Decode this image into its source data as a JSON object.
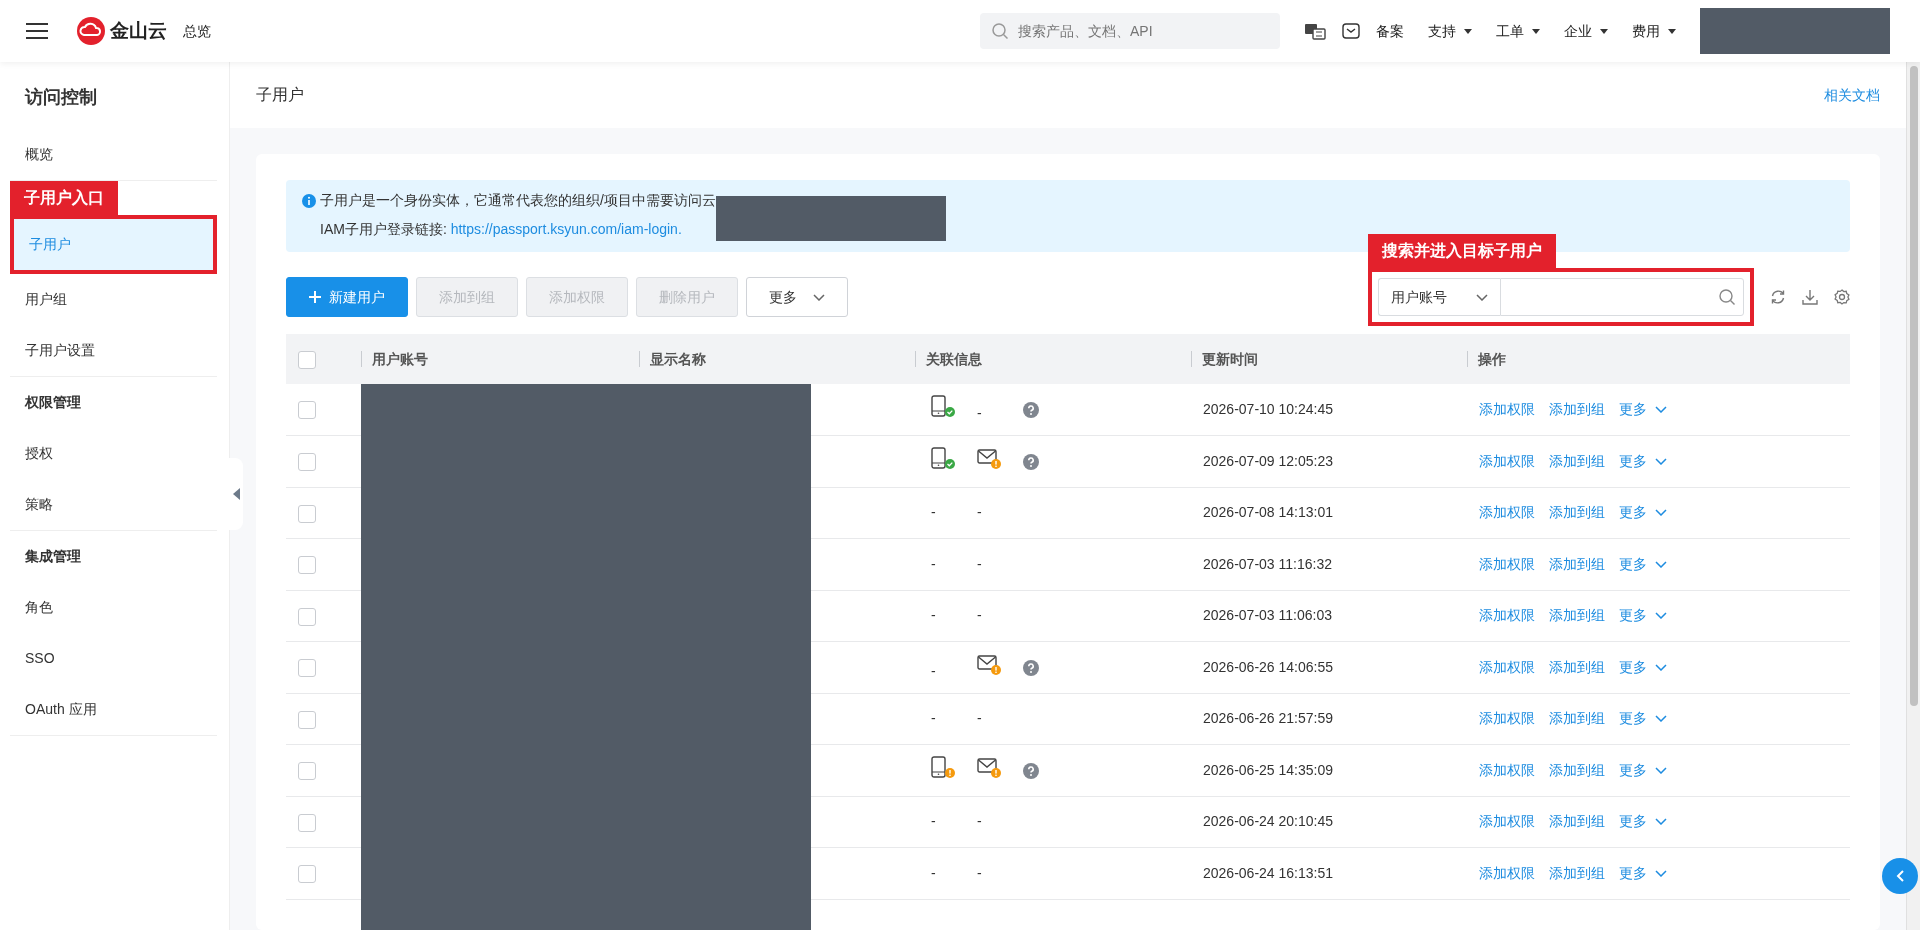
{
  "header": {
    "logo": "金山云",
    "overview": "总览",
    "search": {
      "placeholder": "搜索产品、文档、API"
    },
    "links": [
      {
        "label": "备案",
        "dropdown": false
      },
      {
        "label": "支持",
        "dropdown": true
      },
      {
        "label": "工单",
        "dropdown": true
      },
      {
        "label": "企业",
        "dropdown": true
      },
      {
        "label": "费用",
        "dropdown": true
      }
    ]
  },
  "sidebar": {
    "title": "访问控制",
    "groups": [
      {
        "items": [
          {
            "label": "概览",
            "selected": false
          }
        ]
      },
      {
        "items": [
          {
            "label": "子用户",
            "selected": true
          },
          {
            "label": "用户组",
            "selected": false
          },
          {
            "label": "子用户设置",
            "selected": false
          }
        ]
      },
      {
        "heading": "权限管理",
        "items": [
          {
            "label": "授权",
            "selected": false
          },
          {
            "label": "策略",
            "selected": false
          }
        ]
      },
      {
        "heading": "集成管理",
        "items": [
          {
            "label": "角色",
            "selected": false
          },
          {
            "label": "SSO",
            "selected": false
          },
          {
            "label": "OAuth 应用",
            "selected": false
          }
        ]
      }
    ]
  },
  "page": {
    "title": "子用户",
    "doc_link": "相关文档"
  },
  "notice": {
    "text": "子用户是一个身份实体，它通常代表您的组织/项目中需要访问云",
    "login_label": "IAM子用户登录链接:",
    "login_link": "https://passport.ksyun.com/iam-login."
  },
  "toolbar": {
    "buttons": [
      {
        "label": "新建用户",
        "kind": "primary",
        "disabled": false
      },
      {
        "label": "添加到组",
        "kind": "plain",
        "disabled": true
      },
      {
        "label": "添加权限",
        "kind": "plain",
        "disabled": true
      },
      {
        "label": "删除用户",
        "kind": "plain",
        "disabled": true
      },
      {
        "label": "更多",
        "kind": "dropdown",
        "disabled": false
      }
    ],
    "search_type": "用户账号"
  },
  "table": {
    "header_checked": false,
    "columns": [
      "用户账号",
      "显示名称",
      "关联信息",
      "更新时间",
      "操作"
    ],
    "rows": [
      {
        "checked": false,
        "info": [
          {
            "kind": "phone",
            "verified": true
          },
          {
            "kind": "dash",
            "text": "-"
          },
          {
            "kind": "help"
          }
        ],
        "updated": "2026-07-10 10:24:45",
        "actions": [
          {
            "label": "添加权限",
            "dropdown": false
          },
          {
            "label": "添加到组",
            "dropdown": false
          },
          {
            "label": "更多",
            "dropdown": true
          }
        ]
      },
      {
        "checked": false,
        "info": [
          {
            "kind": "phone",
            "verified": true
          },
          {
            "kind": "mail",
            "verified": false
          },
          {
            "kind": "help"
          }
        ],
        "updated": "2026-07-09 12:05:23",
        "actions": [
          {
            "label": "添加权限",
            "dropdown": false
          },
          {
            "label": "添加到组",
            "dropdown": false
          },
          {
            "label": "更多",
            "dropdown": true
          }
        ]
      },
      {
        "checked": false,
        "info": [
          {
            "kind": "dash",
            "text": "-"
          },
          {
            "kind": "dash",
            "text": "-"
          }
        ],
        "updated": "2026-07-08 14:13:01",
        "actions": [
          {
            "label": "添加权限",
            "dropdown": false
          },
          {
            "label": "添加到组",
            "dropdown": false
          },
          {
            "label": "更多",
            "dropdown": true
          }
        ]
      },
      {
        "checked": false,
        "info": [
          {
            "kind": "dash",
            "text": "-"
          },
          {
            "kind": "dash",
            "text": "-"
          }
        ],
        "updated": "2026-07-03 11:16:32",
        "actions": [
          {
            "label": "添加权限",
            "dropdown": false
          },
          {
            "label": "添加到组",
            "dropdown": false
          },
          {
            "label": "更多",
            "dropdown": true
          }
        ]
      },
      {
        "checked": false,
        "info": [
          {
            "kind": "dash",
            "text": "-"
          },
          {
            "kind": "dash",
            "text": "-"
          }
        ],
        "updated": "2026-07-03 11:06:03",
        "actions": [
          {
            "label": "添加权限",
            "dropdown": false
          },
          {
            "label": "添加到组",
            "dropdown": false
          },
          {
            "label": "更多",
            "dropdown": true
          }
        ]
      },
      {
        "checked": false,
        "info": [
          {
            "kind": "dash",
            "text": "-"
          },
          {
            "kind": "mail",
            "verified": false
          },
          {
            "kind": "help"
          }
        ],
        "updated": "2026-06-26 14:06:55",
        "actions": [
          {
            "label": "添加权限",
            "dropdown": false
          },
          {
            "label": "添加到组",
            "dropdown": false
          },
          {
            "label": "更多",
            "dropdown": true
          }
        ]
      },
      {
        "checked": false,
        "info": [
          {
            "kind": "dash",
            "text": "-"
          },
          {
            "kind": "dash",
            "text": "-"
          }
        ],
        "updated": "2026-06-26 21:57:59",
        "actions": [
          {
            "label": "添加权限",
            "dropdown": false
          },
          {
            "label": "添加到组",
            "dropdown": false
          },
          {
            "label": "更多",
            "dropdown": true
          }
        ]
      },
      {
        "checked": false,
        "info": [
          {
            "kind": "phone",
            "verified": false
          },
          {
            "kind": "mail",
            "verified": false
          },
          {
            "kind": "help"
          }
        ],
        "updated": "2026-06-25 14:35:09",
        "actions": [
          {
            "label": "添加权限",
            "dropdown": false
          },
          {
            "label": "添加到组",
            "dropdown": false
          },
          {
            "label": "更多",
            "dropdown": true
          }
        ]
      },
      {
        "checked": false,
        "info": [
          {
            "kind": "dash",
            "text": "-"
          },
          {
            "kind": "dash",
            "text": "-"
          }
        ],
        "updated": "2026-06-24 20:10:45",
        "actions": [
          {
            "label": "添加权限",
            "dropdown": false
          },
          {
            "label": "添加到组",
            "dropdown": false
          },
          {
            "label": "更多",
            "dropdown": true
          }
        ]
      },
      {
        "checked": false,
        "info": [
          {
            "kind": "dash",
            "text": "-"
          },
          {
            "kind": "dash",
            "text": "-"
          }
        ],
        "updated": "2026-06-24 16:13:51",
        "actions": [
          {
            "label": "添加权限",
            "dropdown": false
          },
          {
            "label": "添加到组",
            "dropdown": false
          },
          {
            "label": "更多",
            "dropdown": true
          }
        ]
      }
    ]
  },
  "annotations": [
    {
      "kind": "sidebar",
      "text": "子用户入口"
    },
    {
      "kind": "search",
      "text": "搜索并进入目标子用户"
    }
  ]
}
